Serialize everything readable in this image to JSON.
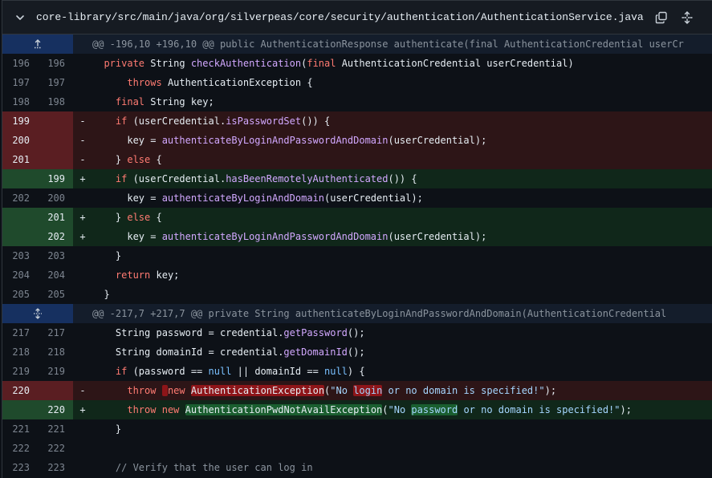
{
  "file": {
    "path": "core-library/src/main/java/org/silverpeas/core/security/authentication/AuthenticationService.java",
    "icons": [
      "chevron-down-icon",
      "copy-icon",
      "expand-all-icon"
    ]
  },
  "colors": {
    "deleted_bg": "#2d1517",
    "added_bg": "#10271a",
    "hunk_bg": "#141d2b",
    "keyword": "#ff7b72",
    "function": "#d2a8ff",
    "string": "#a5d6ff"
  },
  "hunks": [
    {
      "header": "@@ -196,10 +196,10 @@ public AuthenticationResponse authenticate(final AuthenticationCredential userCr"
    },
    {
      "header": "@@ -217,7 +217,7 @@ private String authenticateByLoginAndPasswordAndDomain(AuthenticationCredential"
    }
  ],
  "lines": [
    {
      "old": "196",
      "new": "196",
      "sign": "",
      "code": "  private String checkAuthentication(final AuthenticationCredential userCredential)"
    },
    {
      "old": "197",
      "new": "197",
      "sign": "",
      "code": "      throws AuthenticationException {"
    },
    {
      "old": "198",
      "new": "198",
      "sign": "",
      "code": "    final String key;"
    },
    {
      "old": "199",
      "new": "",
      "sign": "-",
      "code": "    if (userCredential.isPasswordSet()) {"
    },
    {
      "old": "200",
      "new": "",
      "sign": "-",
      "code": "      key = authenticateByLoginAndPasswordAndDomain(userCredential);"
    },
    {
      "old": "201",
      "new": "",
      "sign": "-",
      "code": "    } else {"
    },
    {
      "old": "",
      "new": "199",
      "sign": "+",
      "code": "    if (userCredential.hasBeenRemotelyAuthenticated()) {"
    },
    {
      "old": "202",
      "new": "200",
      "sign": "",
      "code": "      key = authenticateByLoginAndDomain(userCredential);"
    },
    {
      "old": "",
      "new": "201",
      "sign": "+",
      "code": "    } else {"
    },
    {
      "old": "",
      "new": "202",
      "sign": "+",
      "code": "      key = authenticateByLoginAndPasswordAndDomain(userCredential);"
    },
    {
      "old": "203",
      "new": "203",
      "sign": "",
      "code": "    }"
    },
    {
      "old": "204",
      "new": "204",
      "sign": "",
      "code": "    return key;"
    },
    {
      "old": "205",
      "new": "205",
      "sign": "",
      "code": "  }"
    },
    {
      "old": "217",
      "new": "217",
      "sign": "",
      "code": "    String password = credential.getPassword();"
    },
    {
      "old": "218",
      "new": "218",
      "sign": "",
      "code": "    String domainId = credential.getDomainId();"
    },
    {
      "old": "219",
      "new": "219",
      "sign": "",
      "code": "    if (password == null || domainId == null) {"
    },
    {
      "old": "220",
      "new": "",
      "sign": "-",
      "code": "      throw  new AuthenticationException(\"No login or no domain is specified!\");"
    },
    {
      "old": "",
      "new": "220",
      "sign": "+",
      "code": "      throw new AuthenticationPwdNotAvailException(\"No password or no domain is specified!\");"
    },
    {
      "old": "221",
      "new": "221",
      "sign": "",
      "code": "    }"
    },
    {
      "old": "222",
      "new": "222",
      "sign": "",
      "code": ""
    },
    {
      "old": "223",
      "new": "223",
      "sign": "",
      "code": "    // Verify that the user can log in"
    }
  ]
}
